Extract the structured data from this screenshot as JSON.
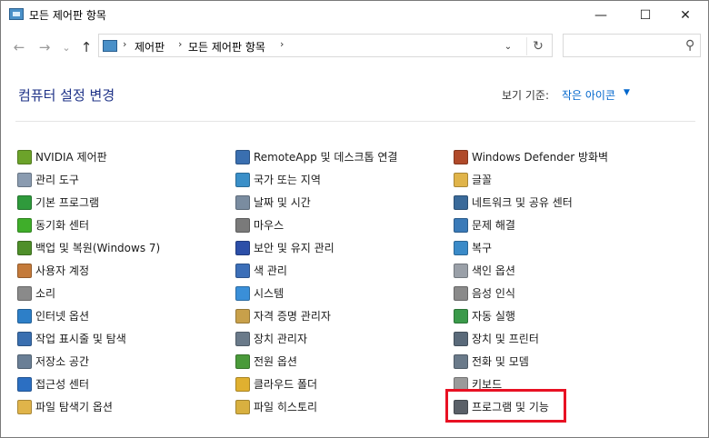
{
  "window": {
    "title": "모든 제어판 항목",
    "minimize_glyph": "—",
    "maximize_glyph": "☐",
    "close_glyph": "✕"
  },
  "nav": {
    "back_glyph": "←",
    "forward_glyph": "→",
    "recent_glyph": "⌄",
    "up_glyph": "↑"
  },
  "address": {
    "breadcrumbs": [
      "제어판",
      "모든 제어판 항목"
    ],
    "separator": "›",
    "dropdown_glyph": "⌄",
    "refresh_glyph": "↻"
  },
  "search": {
    "placeholder": "",
    "icon_glyph": "⚲"
  },
  "content": {
    "heading": "컴퓨터 설정 변경",
    "view_by_label": "보기 기준:",
    "view_by_value": "작은 아이콘",
    "view_by_caret": "▼"
  },
  "columns": [
    [
      {
        "label": "NVIDIA 제어판",
        "icon": "nvidia-icon",
        "color": "#6ca32a"
      },
      {
        "label": "관리 도구",
        "icon": "admin-tools-icon",
        "color": "#8a9bb0"
      },
      {
        "label": "기본 프로그램",
        "icon": "default-programs-icon",
        "color": "#2f9a3c"
      },
      {
        "label": "동기화 센터",
        "icon": "sync-center-icon",
        "color": "#3fae2a"
      },
      {
        "label": "백업 및 복원(Windows 7)",
        "icon": "backup-icon",
        "color": "#4f8f2a"
      },
      {
        "label": "사용자 계정",
        "icon": "user-accounts-icon",
        "color": "#c47a3a"
      },
      {
        "label": "소리",
        "icon": "sound-icon",
        "color": "#8a8a8a"
      },
      {
        "label": "인터넷 옵션",
        "icon": "internet-options-icon",
        "color": "#2d7fc8"
      },
      {
        "label": "작업 표시줄 및 탐색",
        "icon": "taskbar-icon",
        "color": "#3a6fb0"
      },
      {
        "label": "저장소 공간",
        "icon": "storage-spaces-icon",
        "color": "#6a7f96"
      },
      {
        "label": "접근성 센터",
        "icon": "ease-of-access-icon",
        "color": "#2c6fc2"
      },
      {
        "label": "파일 탐색기 옵션",
        "icon": "folder-options-icon",
        "color": "#e0b44a"
      }
    ],
    [
      {
        "label": "RemoteApp 및 데스크톱 연결",
        "icon": "remoteapp-icon",
        "color": "#3a6fb0"
      },
      {
        "label": "국가 또는 지역",
        "icon": "region-icon",
        "color": "#3a8fc8"
      },
      {
        "label": "날짜 및 시간",
        "icon": "date-time-icon",
        "color": "#7a8ca0"
      },
      {
        "label": "마우스",
        "icon": "mouse-icon",
        "color": "#7a7a7a"
      },
      {
        "label": "보안 및 유지 관리",
        "icon": "security-maintenance-icon",
        "color": "#2c4fa8"
      },
      {
        "label": "색 관리",
        "icon": "color-management-icon",
        "color": "#3c6fb8"
      },
      {
        "label": "시스템",
        "icon": "system-icon",
        "color": "#3a8fd8"
      },
      {
        "label": "자격 증명 관리자",
        "icon": "credential-manager-icon",
        "color": "#c8a04a"
      },
      {
        "label": "장치 관리자",
        "icon": "device-manager-icon",
        "color": "#6a7a8a"
      },
      {
        "label": "전원 옵션",
        "icon": "power-options-icon",
        "color": "#4a9a3a"
      },
      {
        "label": "클라우드 폴더",
        "icon": "work-folders-icon",
        "color": "#e0b030"
      },
      {
        "label": "파일 히스토리",
        "icon": "file-history-icon",
        "color": "#d8b040"
      }
    ],
    [
      {
        "label": "Windows Defender 방화벽",
        "icon": "firewall-icon",
        "color": "#b04a2a"
      },
      {
        "label": "글꼴",
        "icon": "fonts-icon",
        "color": "#e0b44a"
      },
      {
        "label": "네트워크 및 공유 센터",
        "icon": "network-sharing-icon",
        "color": "#3a6a9a"
      },
      {
        "label": "문제 해결",
        "icon": "troubleshooting-icon",
        "color": "#3a7ab8"
      },
      {
        "label": "복구",
        "icon": "recovery-icon",
        "color": "#3a8ac8"
      },
      {
        "label": "색인 옵션",
        "icon": "indexing-options-icon",
        "color": "#9aa0a8"
      },
      {
        "label": "음성 인식",
        "icon": "speech-recognition-icon",
        "color": "#8a8a8a"
      },
      {
        "label": "자동 실행",
        "icon": "autoplay-icon",
        "color": "#3a9a4a"
      },
      {
        "label": "장치 및 프린터",
        "icon": "devices-printers-icon",
        "color": "#5a6a7a"
      },
      {
        "label": "전화 및 모뎀",
        "icon": "phone-modem-icon",
        "color": "#6a7a8a"
      },
      {
        "label": "키보드",
        "icon": "keyboard-icon",
        "color": "#9a9a9a"
      },
      {
        "label": "프로그램 및 기능",
        "icon": "programs-features-icon",
        "color": "#5a6068"
      }
    ]
  ],
  "highlight_color": "#e81123"
}
